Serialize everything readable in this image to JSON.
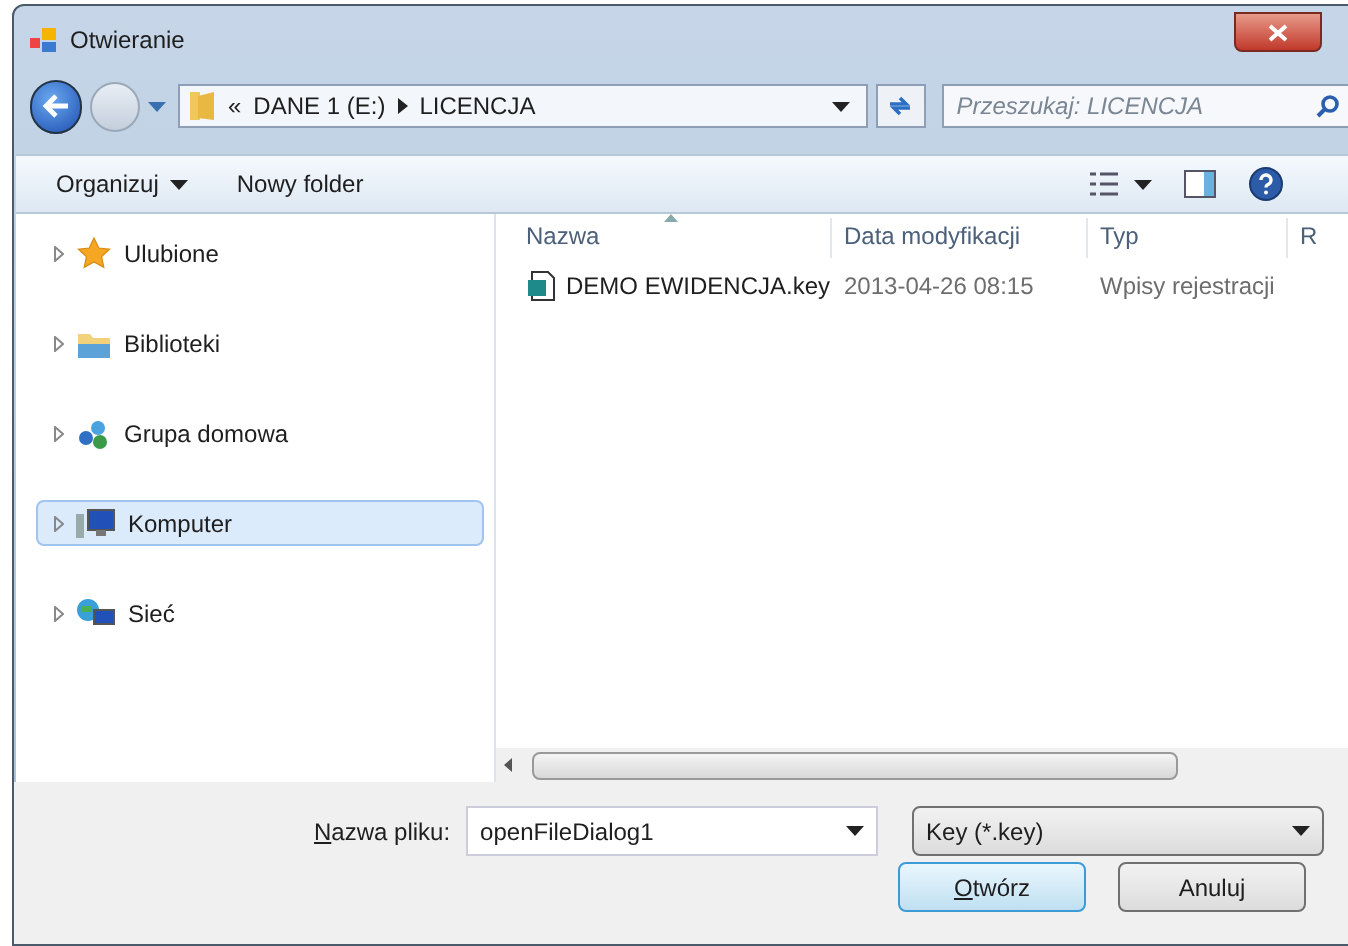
{
  "window": {
    "title": "Otwieranie"
  },
  "address": {
    "overflow": "«",
    "crumbs": [
      "DANE 1 (E:)",
      "LICENCJA"
    ]
  },
  "search": {
    "placeholder": "Przeszukaj: LICENCJA"
  },
  "toolbar": {
    "organize": "Organizuj",
    "new_folder": "Nowy folder"
  },
  "sidebar": {
    "items": [
      {
        "label": "Ulubione",
        "kind": "favorites",
        "selected": false
      },
      {
        "label": "Biblioteki",
        "kind": "libraries",
        "selected": false
      },
      {
        "label": "Grupa domowa",
        "kind": "homegroup",
        "selected": false
      },
      {
        "label": "Komputer",
        "kind": "computer",
        "selected": true
      },
      {
        "label": "Sieć",
        "kind": "network",
        "selected": false
      }
    ]
  },
  "table": {
    "columns": [
      "Nazwa",
      "Data modyfikacji",
      "Typ",
      "R"
    ],
    "rows": [
      {
        "cells": [
          "DEMO EWIDENCJA.key",
          "2013-04-26 08:15",
          "Wpisy rejestracji"
        ]
      }
    ]
  },
  "footer": {
    "filename_label": "Nazwa pliku:",
    "filename": "openFileDialog1",
    "filter": "Key (*.key)",
    "open": "Otwórz",
    "cancel": "Anuluj"
  }
}
